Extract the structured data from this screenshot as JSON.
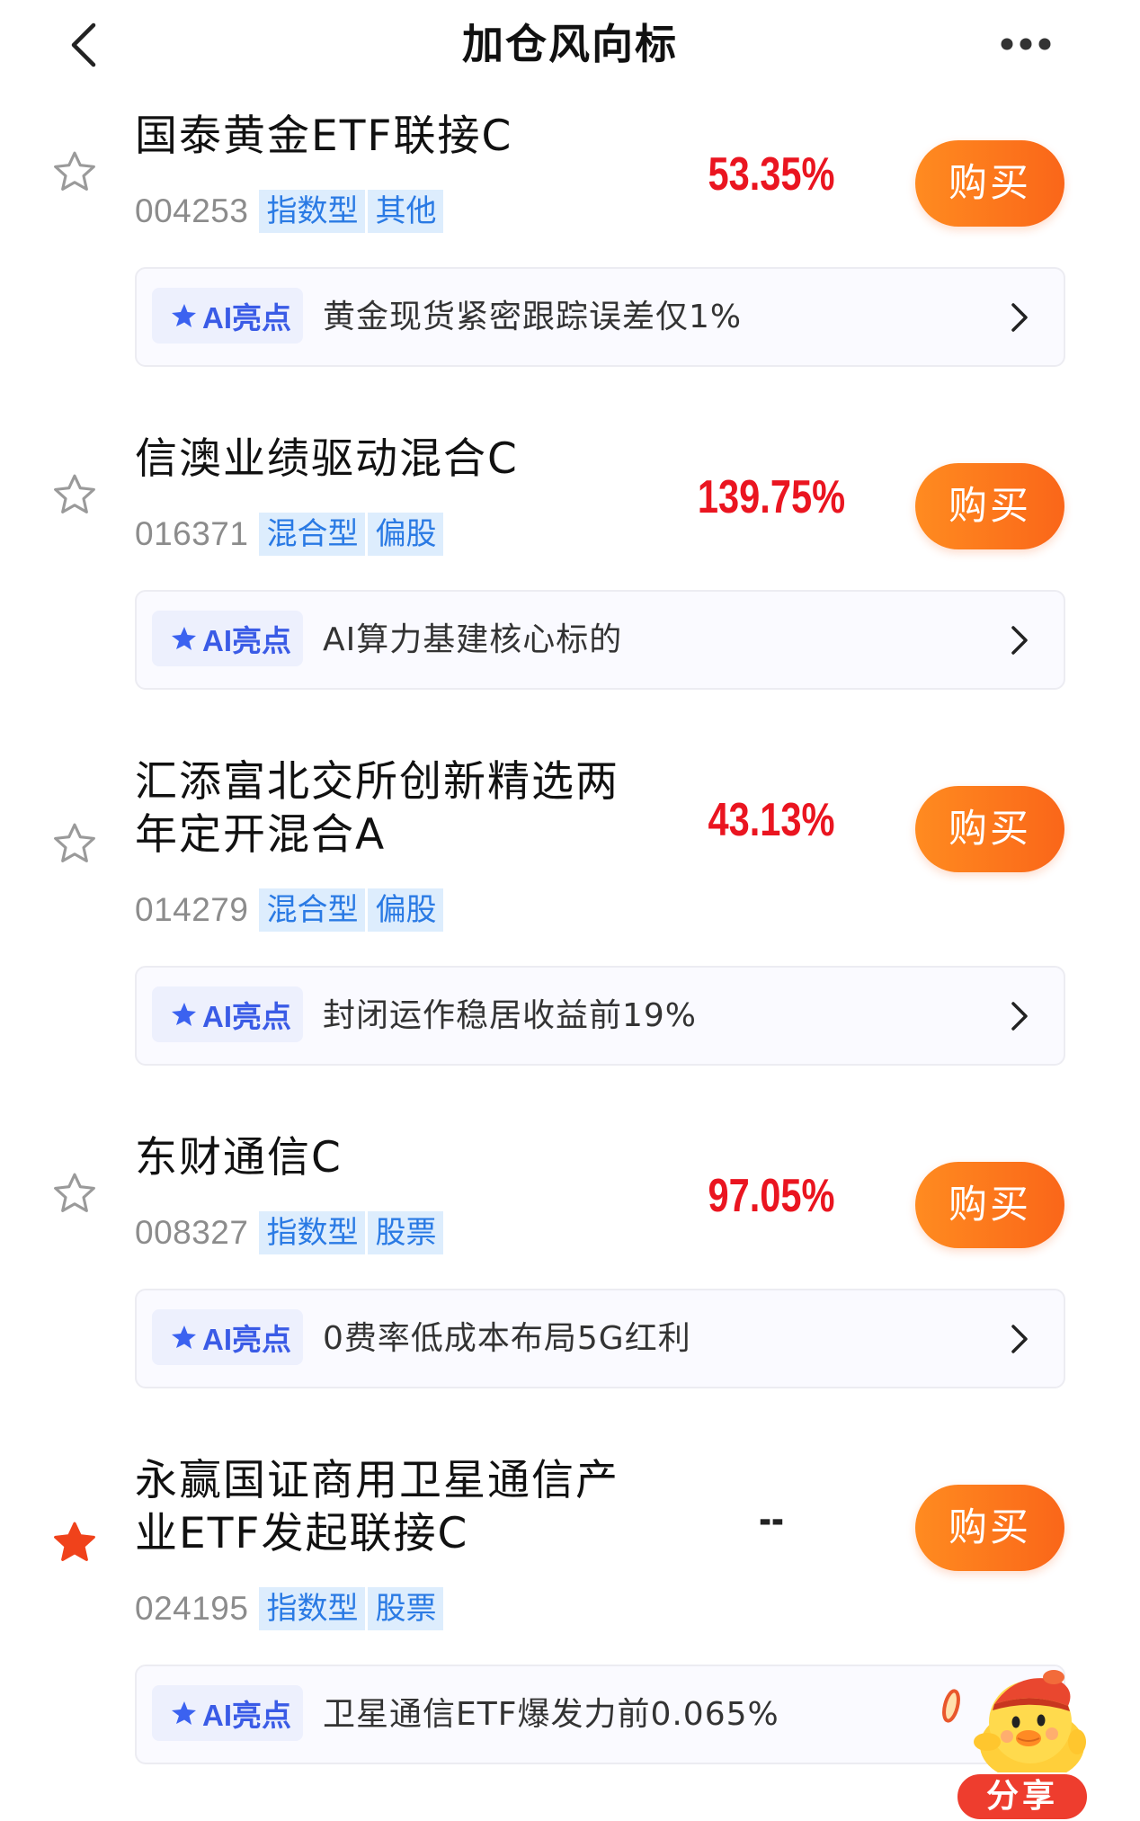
{
  "header": {
    "title": "加仓风向标",
    "back_icon": "chevron-left-icon",
    "more_icon": "more-dots-icon"
  },
  "labels": {
    "buy": "购买",
    "ai_badge": "AI亮点"
  },
  "funds": [
    {
      "name": "国泰黄金ETF联接C",
      "code": "004253",
      "tags": [
        "指数型",
        "其他"
      ],
      "return": "53.35%",
      "favorited": false,
      "ai_text": "黄金现货紧密跟踪误差仅1%"
    },
    {
      "name": "信澳业绩驱动混合C",
      "code": "016371",
      "tags": [
        "混合型",
        "偏股"
      ],
      "return": "139.75%",
      "favorited": false,
      "ai_text": "AI算力基建核心标的"
    },
    {
      "name": "汇添富北交所创新精选两年定开混合A",
      "code": "014279",
      "tags": [
        "混合型",
        "偏股"
      ],
      "return": "43.13%",
      "favorited": false,
      "ai_text": "封闭运作稳居收益前19%"
    },
    {
      "name": "东财通信C",
      "code": "008327",
      "tags": [
        "指数型",
        "股票"
      ],
      "return": "97.05%",
      "favorited": false,
      "ai_text": "0费率低成本布局5G红利"
    },
    {
      "name": "永赢国证商用卫星通信产业ETF发起联接C",
      "code": "024195",
      "tags": [
        "指数型",
        "股票"
      ],
      "return": "--",
      "favorited": true,
      "ai_text": "卫星通信ETF爆发力前0.065%"
    }
  ],
  "share": {
    "label": "分享",
    "mascot_icon": "chick-mascot-icon"
  },
  "colors": {
    "return_positive": "#ea1520",
    "buy_button_start": "#ff8b20",
    "buy_button_end": "#fa6619",
    "tag_background": "#ddedfd",
    "tag_text": "#2a7ae4",
    "ai_badge_text": "#3a5be6",
    "favorite_star": "#f0421b",
    "share_badge": "#ee3d2e"
  }
}
